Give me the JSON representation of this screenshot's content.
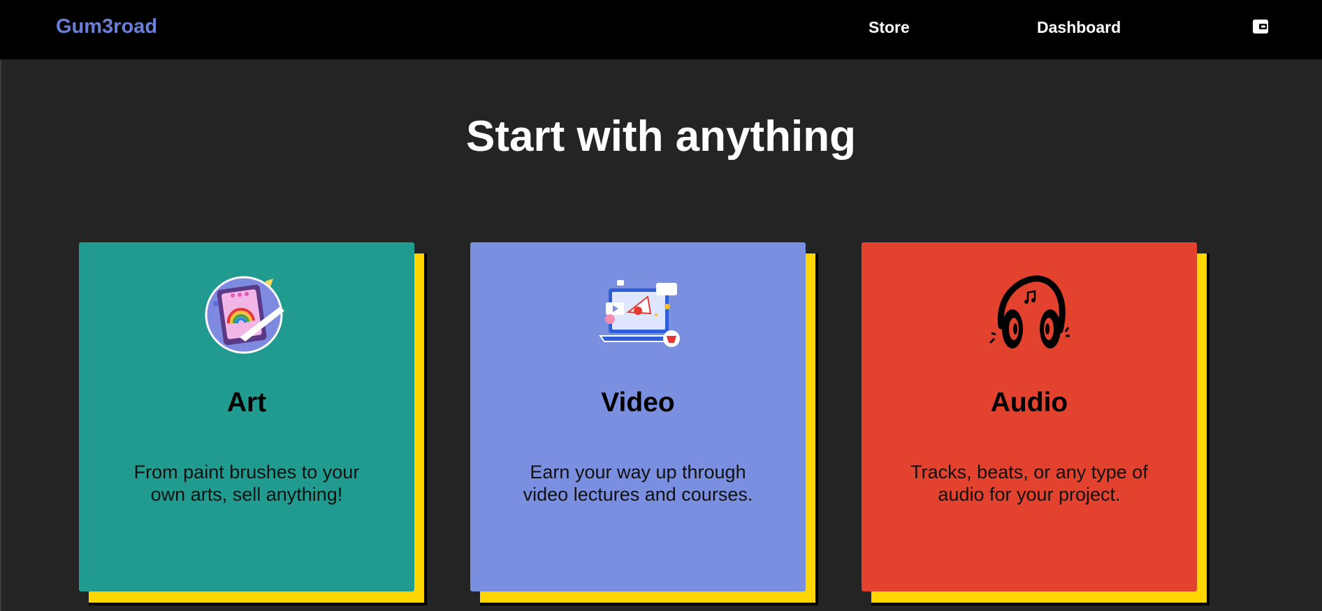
{
  "nav": {
    "brand": "Gum3road",
    "links": [
      "Store",
      "Dashboard"
    ],
    "wallet_icon": "wallet-icon"
  },
  "hero": {
    "title": "Start with anything"
  },
  "cards": [
    {
      "title": "Art",
      "description": "From paint brushes to your own arts, sell anything!",
      "color": "#219b8f",
      "icon": "art-tablet-icon"
    },
    {
      "title": "Video",
      "description": "Earn your way up through video lectures and courses.",
      "color": "#7b8fe0",
      "icon": "video-laptop-icon"
    },
    {
      "title": "Audio",
      "description": "Tracks, beats, or any type of audio for your project.",
      "color": "#e2422e",
      "icon": "headphones-icon"
    }
  ],
  "colors": {
    "navbar": "#000000",
    "background": "#242424",
    "brand": "#6b7fd6",
    "card_shadow": "#ffd600"
  }
}
